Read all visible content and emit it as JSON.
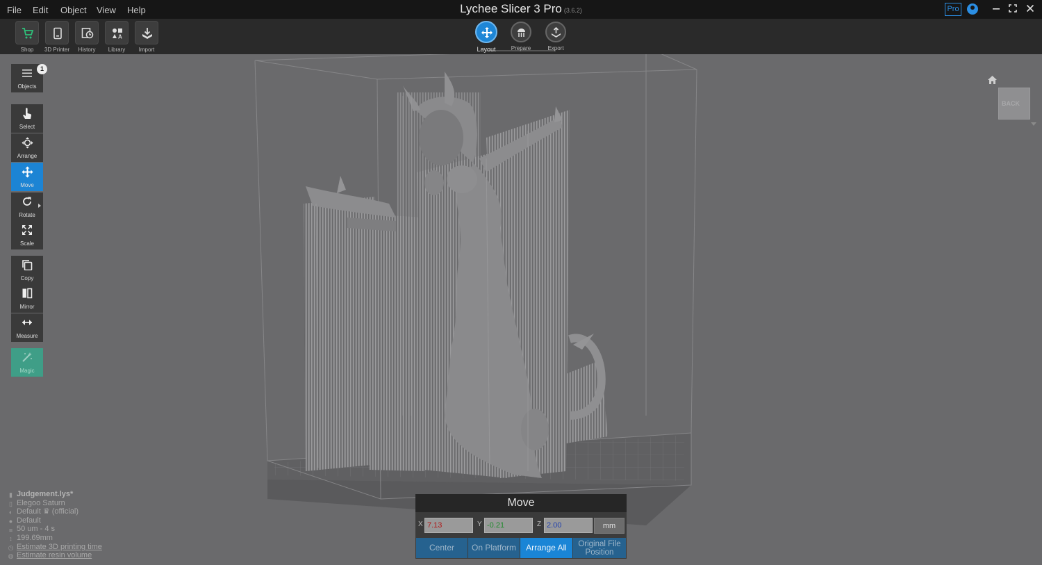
{
  "menu": [
    "File",
    "Edit",
    "Object",
    "View",
    "Help"
  ],
  "app": {
    "title": "Lychee Slicer 3 Pro",
    "version": "(3.6.2)",
    "pro_badge": "Pro"
  },
  "toolbar": [
    {
      "label": "Shop",
      "icon": "cart-icon"
    },
    {
      "label": "3D Printer",
      "icon": "printer-icon"
    },
    {
      "label": "History",
      "icon": "history-icon"
    },
    {
      "label": "Library",
      "icon": "library-icon"
    },
    {
      "label": "Import",
      "icon": "import-icon"
    }
  ],
  "steps": [
    {
      "label": "Layout",
      "active": true
    },
    {
      "label": "Prepare",
      "active": false
    },
    {
      "label": "Export",
      "active": false
    }
  ],
  "sidebar": {
    "objects": {
      "label": "Objects",
      "count": "1"
    },
    "select": "Select",
    "arrange": "Arrange",
    "move": "Move",
    "rotate": "Rotate",
    "scale": "Scale",
    "copy": "Copy",
    "mirror": "Mirror",
    "measure": "Measure",
    "magic": "Magic"
  },
  "view_cube": {
    "face": "BACK"
  },
  "info": {
    "file": "Judgement.lys*",
    "printer": "Elegoo Saturn",
    "profile": "Default",
    "profile_suffix": "(official)",
    "resin": "Default",
    "layer": "50 um - 4 s",
    "height": "199.69mm",
    "estimate_time": "Estimate 3D printing time",
    "estimate_resin": "Estimate resin volume"
  },
  "move_panel": {
    "title": "Move",
    "x_label": "X",
    "x_value": "7.13",
    "x_color": "#b01818",
    "y_label": "Y",
    "y_value": "-0.21",
    "y_color": "#1d8a2a",
    "z_label": "Z",
    "z_value": "2.00",
    "z_color": "#1f3fae",
    "unit": "mm",
    "buttons": {
      "center": "Center",
      "on_platform": "On Platform",
      "arrange_all": "Arrange All",
      "original_line1": "Original File",
      "original_line2": "Position"
    }
  }
}
